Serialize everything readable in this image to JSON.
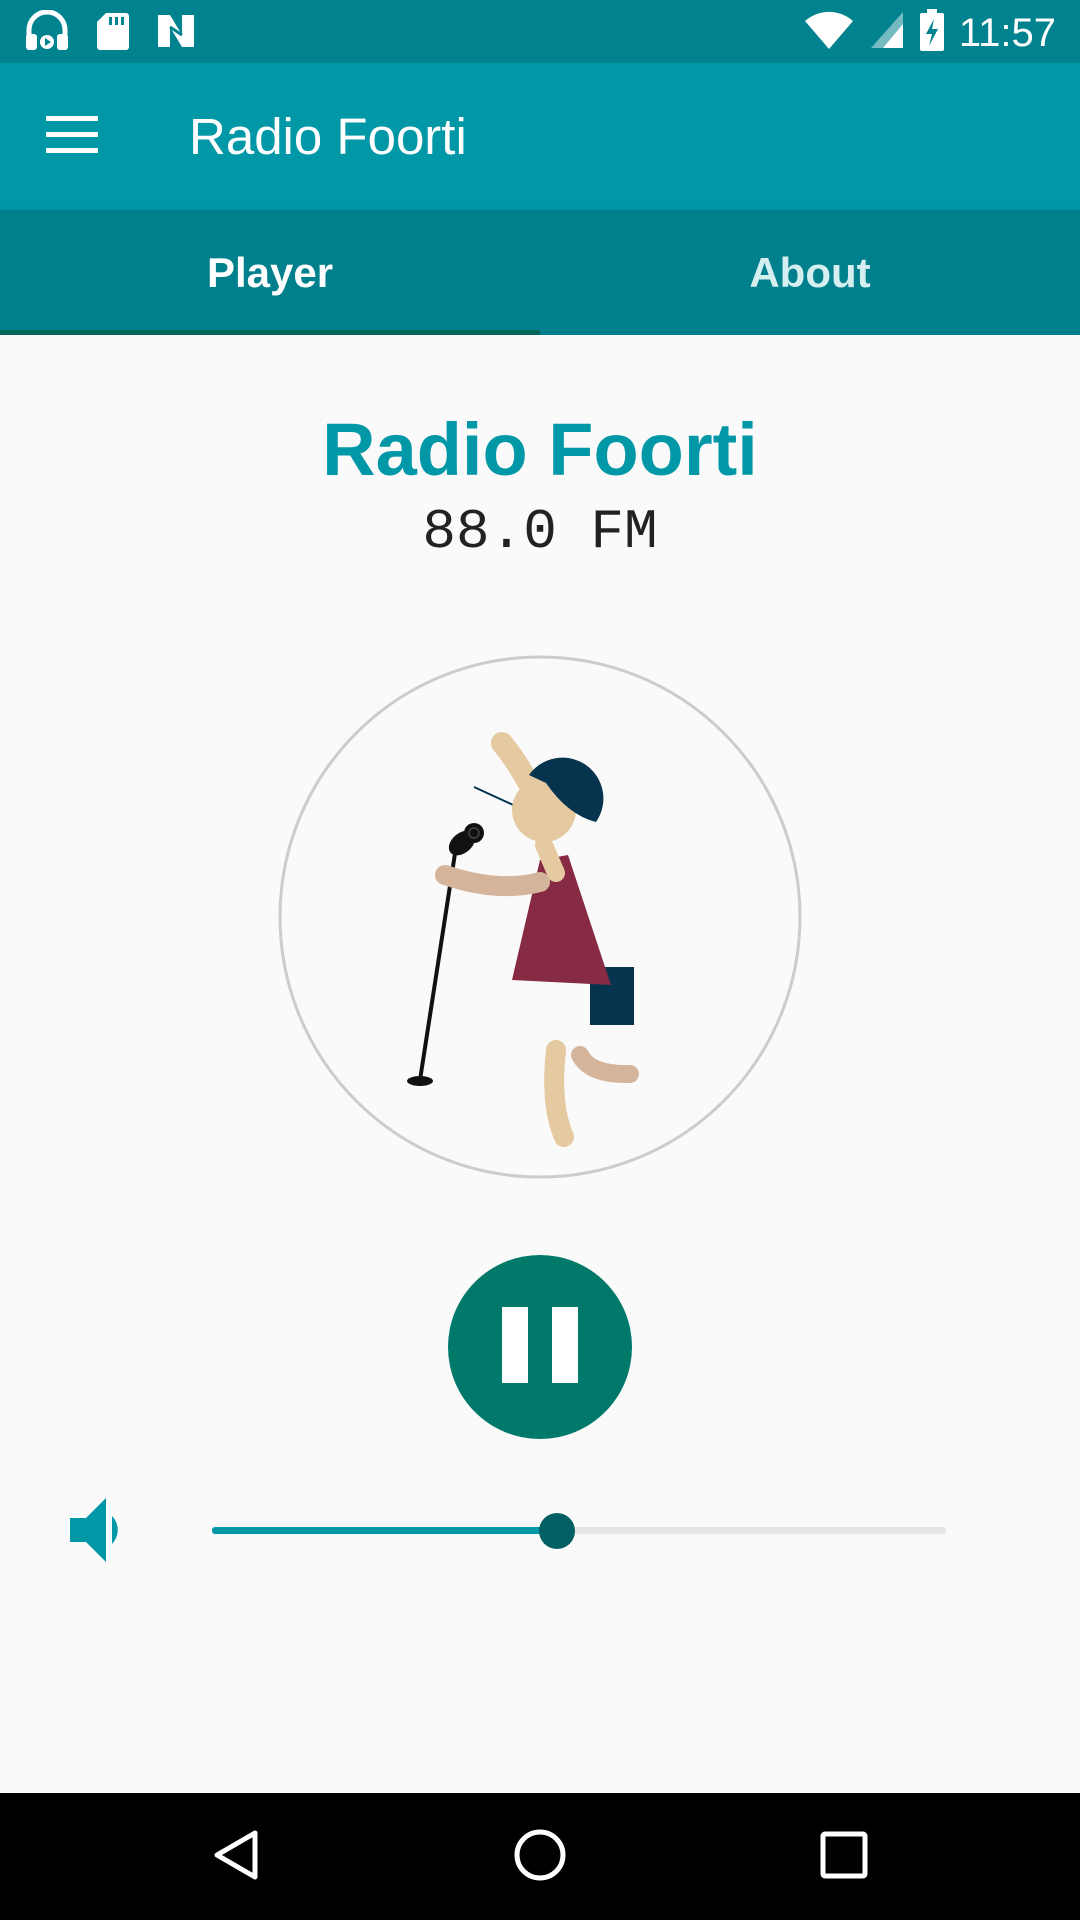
{
  "status_bar": {
    "time": "11:57",
    "icons": [
      "headset-icon",
      "sd-card-icon",
      "n-logo-icon",
      "wifi-icon",
      "cell-signal-icon",
      "battery-charging-icon"
    ],
    "background": "#00838f"
  },
  "app_bar": {
    "title": "Radio Foorti",
    "menu_icon": "hamburger-menu-icon",
    "background": "#0097a7"
  },
  "tabs": [
    {
      "label": "Player",
      "selected": true
    },
    {
      "label": "About",
      "selected": false
    }
  ],
  "player": {
    "station_name": "Radio Foorti",
    "frequency": "88.0 FM",
    "artwork": "singer-illustration",
    "control_icon": "pause-icon",
    "volume_icon": "volume-up-icon",
    "volume_level": 0.47
  },
  "nav_bar": {
    "icons": [
      "back-icon",
      "home-icon",
      "recents-icon"
    ]
  },
  "colors": {
    "accent": "#0097a7",
    "primary_dark": "#00838f",
    "play_button": "#00796b",
    "slider_thumb": "#006064"
  }
}
